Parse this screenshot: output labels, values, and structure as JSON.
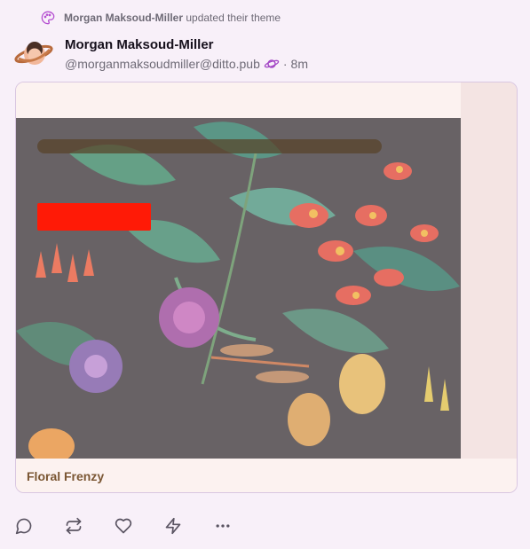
{
  "activity": {
    "actor": "Morgan Maksoud-Miller",
    "text": "updated their theme",
    "icon": "palette-icon"
  },
  "author": {
    "display_name": "Morgan Maksoud-Miller",
    "handle": "@morganmaksoudmiller@ditto.pub",
    "badge_icon": "planet-icon",
    "separator": "·",
    "time": "8m"
  },
  "theme_card": {
    "name": "Floral Frenzy",
    "colors": {
      "background": "#fcf2f0",
      "secondary": "#f4e4e3",
      "accent": "#ff1a06",
      "text": "#7a5633"
    }
  },
  "actions": [
    {
      "name": "reply",
      "icon": "comment-icon"
    },
    {
      "name": "repost",
      "icon": "repost-icon"
    },
    {
      "name": "like",
      "icon": "heart-icon"
    },
    {
      "name": "zap",
      "icon": "lightning-icon"
    },
    {
      "name": "more",
      "icon": "more-icon"
    }
  ]
}
